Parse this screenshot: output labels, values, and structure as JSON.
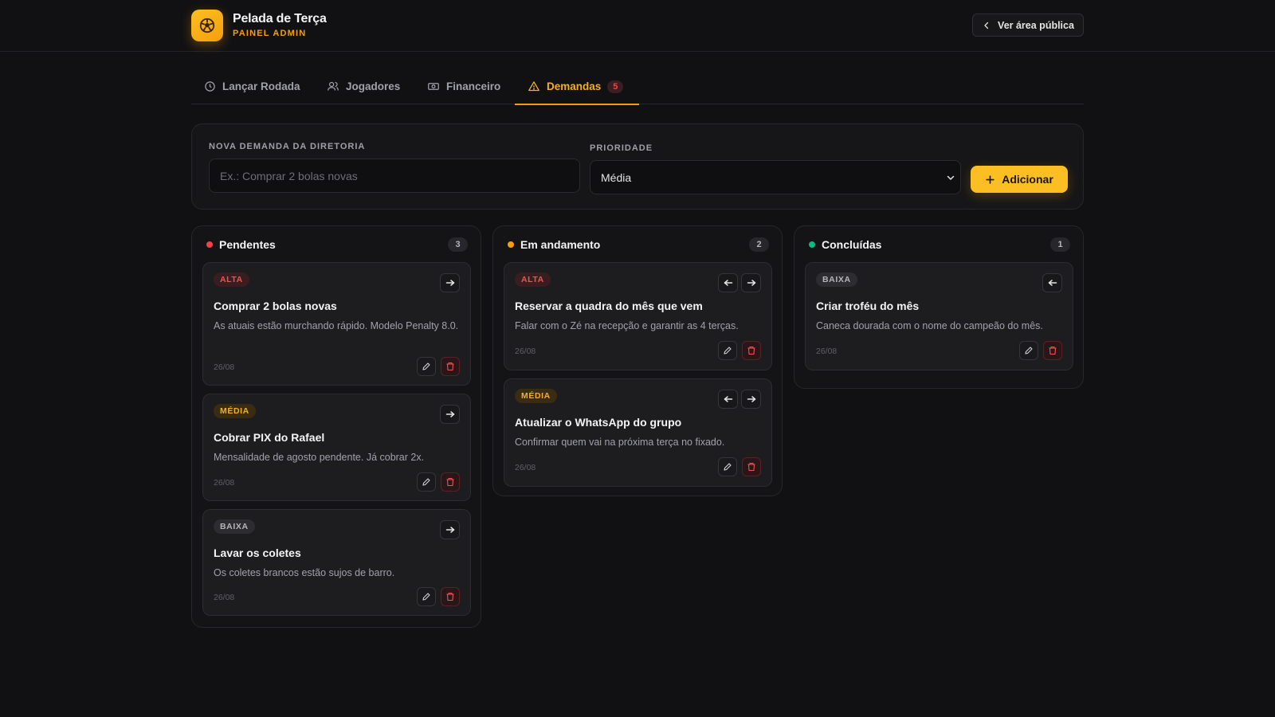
{
  "header": {
    "title": "Pelada de Terça",
    "subtitle": "PAINEL ADMIN",
    "public_button": "Ver área pública"
  },
  "tabs": [
    {
      "label": "Lançar Rodada",
      "icon": "clock-icon"
    },
    {
      "label": "Jogadores",
      "icon": "users-icon"
    },
    {
      "label": "Financeiro",
      "icon": "money-icon"
    },
    {
      "label": "Demandas",
      "icon": "alert-triangle-icon",
      "badge": "5",
      "active": true
    }
  ],
  "form": {
    "demand_label": "NOVA DEMANDA DA DIRETORIA",
    "demand_placeholder": "Ex.: Comprar 2 bolas novas",
    "priority_label": "PRIORIDADE",
    "priority_value": "Média",
    "add_button": "Adicionar"
  },
  "colors": {
    "accent": "#f59e0b",
    "pending": "#ef4444",
    "in_progress": "#f59e0b",
    "done": "#10b981"
  },
  "columns": [
    {
      "title": "Pendentes",
      "count": "3",
      "cards": [
        {
          "priority": "ALTA",
          "title": "Comprar 2 bolas novas",
          "desc": "As atuais estão murchando rápido. Modelo Penalty 8.0.",
          "date": "26/08"
        },
        {
          "priority": "MÉDIA",
          "title": "Cobrar PIX do Rafael",
          "desc": "Mensalidade de agosto pendente. Já cobrar 2x.",
          "date": "26/08"
        },
        {
          "priority": "BAIXA",
          "title": "Lavar os coletes",
          "desc": "Os coletes brancos estão sujos de barro.",
          "date": "26/08"
        }
      ]
    },
    {
      "title": "Em andamento",
      "count": "2",
      "cards": [
        {
          "priority": "ALTA",
          "title": "Reservar a quadra do mês que vem",
          "desc": "Falar com o Zé na recepção e garantir as 4 terças.",
          "date": "26/08"
        },
        {
          "priority": "MÉDIA",
          "title": "Atualizar o WhatsApp do grupo",
          "desc": "Confirmar quem vai na próxima terça no fixado.",
          "date": "26/08"
        }
      ]
    },
    {
      "title": "Concluídas",
      "count": "1",
      "cards": [
        {
          "priority": "BAIXA",
          "title": "Criar troféu do mês",
          "desc": "Caneca dourada com o nome do campeão do mês.",
          "date": "26/08"
        }
      ]
    }
  ]
}
